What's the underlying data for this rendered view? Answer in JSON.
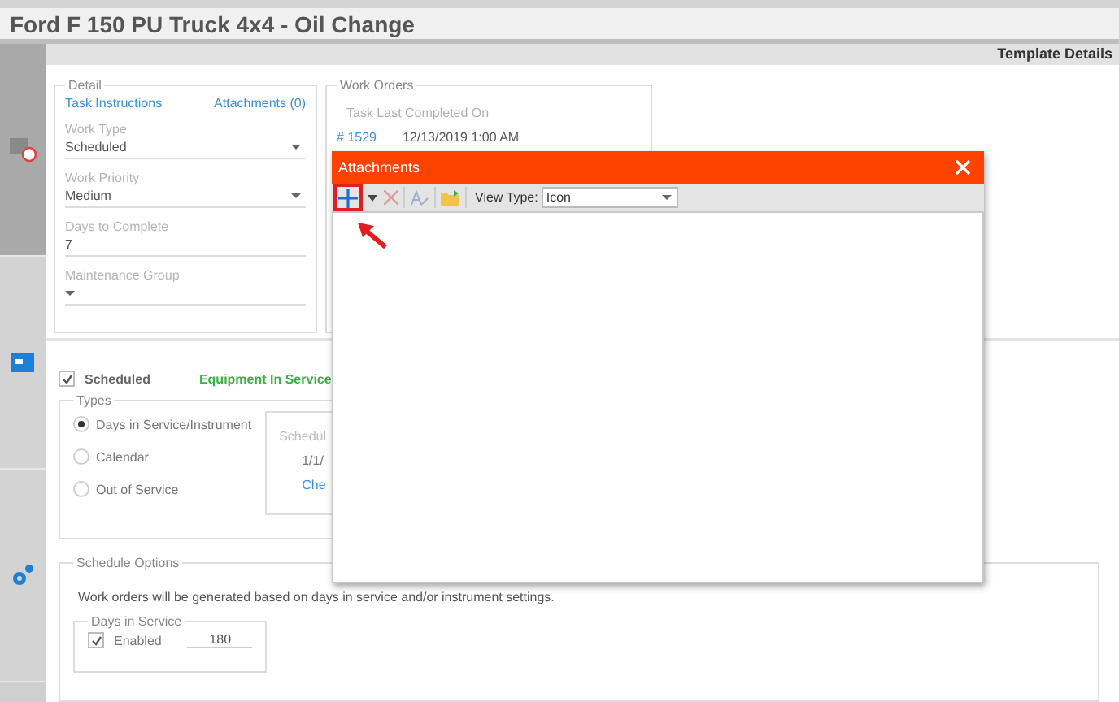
{
  "window": {
    "title": "Ford F 150 PU Truck 4x4 - Oil Change"
  },
  "header": {
    "title": "Template Details"
  },
  "sidebar": {
    "items": [
      {
        "kind": "calendar",
        "selected": true
      },
      {
        "kind": "window",
        "selected": false
      },
      {
        "kind": "gears",
        "selected": false
      }
    ]
  },
  "detail": {
    "legend": "Detail",
    "links": [
      "Task Instructions",
      "Attachments (0)"
    ],
    "fields": [
      {
        "label": "Work Type",
        "value": "Scheduled",
        "kind": "dropdown"
      },
      {
        "label": "Work Priority",
        "value": "Medium",
        "kind": "dropdown"
      },
      {
        "label": "Days to Complete",
        "value": "7",
        "kind": "text"
      },
      {
        "label": "Maintenance Group",
        "kind": "dropdown"
      }
    ]
  },
  "work_orders": {
    "legend": "Work Orders",
    "heading": "Task Last Completed On",
    "rows": [
      {
        "number": "# 1529",
        "date": "12/13/2019 1:00 AM"
      }
    ]
  },
  "schedule": {
    "scheduled": {
      "label": "Scheduled",
      "checked": true
    },
    "status": "Equipment In Service",
    "types": {
      "legend": "Types",
      "options": [
        {
          "label": "Days in Service/Instrument",
          "selected": true
        },
        {
          "label": "Calendar",
          "selected": false
        },
        {
          "label": "Out of Service",
          "selected": false
        }
      ]
    },
    "schedule_box": {
      "heading": "Schedul",
      "date": "1/1/",
      "link": "Che"
    },
    "options": {
      "legend": "Schedule Options",
      "note": "Work orders will be generated based on days in service and/or instrument settings.",
      "days_in_service": {
        "legend": "Days in Service",
        "enabled": {
          "label": "Enabled",
          "checked": true
        },
        "value": "180"
      }
    }
  },
  "dialog": {
    "title": "Attachments",
    "tools": [
      {
        "kind": "add",
        "disabled": false,
        "highlighted": true
      },
      {
        "kind": "caret",
        "disabled": false,
        "highlighted": false
      },
      {
        "kind": "delete",
        "disabled": true,
        "highlighted": false
      },
      {
        "kind": "rename",
        "disabled": true,
        "highlighted": false
      },
      {
        "kind": "folder",
        "disabled": false,
        "highlighted": false
      }
    ],
    "view_type": {
      "label": "View Type:",
      "value": "Icon"
    }
  }
}
